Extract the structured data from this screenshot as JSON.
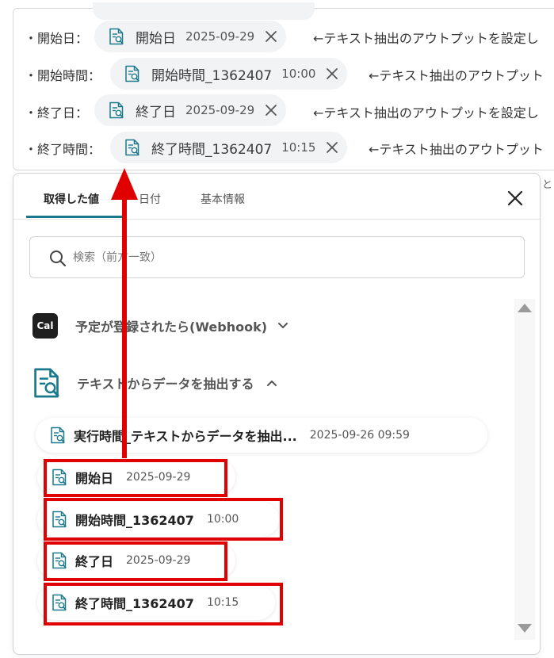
{
  "form": {
    "rows": [
      {
        "label": "・開始日：",
        "chip_name": "開始日",
        "chip_value": "2025-09-29",
        "note": "←テキスト抽出のアウトプットを設定し"
      },
      {
        "label": "・開始時間：",
        "chip_name": "開始時間_1362407",
        "chip_value": "10:00",
        "note": "←テキスト抽出のアウトプット"
      },
      {
        "label": "・終了日：",
        "chip_name": "終了日",
        "chip_value": "2025-09-29",
        "note": "←テキスト抽出のアウトプットを設定し"
      },
      {
        "label": "・終了時間：",
        "chip_name": "終了時間_1362407",
        "chip_value": "10:15",
        "note": "←テキスト抽出のアウトプット"
      }
    ],
    "right_edge_text": "と"
  },
  "dropdown": {
    "tabs": [
      {
        "label": "取得した値",
        "active": true
      },
      {
        "label": "日付",
        "active": false
      },
      {
        "label": "基本情報",
        "active": false
      }
    ],
    "search_placeholder": "検索（前方一致）",
    "sections": [
      {
        "logo_text": "Cal",
        "title": "予定が登録されたら(Webhook)",
        "state": "collapsed"
      },
      {
        "title": "テキストからデータを抽出する",
        "state": "expanded"
      }
    ],
    "items": [
      {
        "name": "実行時間_テキストからデータを抽出...",
        "value": "2025-09-26 09:59",
        "highlighted": false
      },
      {
        "name": "開始日",
        "value": "2025-09-29",
        "highlighted": true
      },
      {
        "name": "開始時間_1362407",
        "value": "10:00",
        "highlighted": true
      },
      {
        "name": "終了日",
        "value": "2025-09-29",
        "highlighted": true
      },
      {
        "name": "終了時間_1362407",
        "value": "10:15",
        "highlighted": true
      }
    ]
  },
  "colors": {
    "accent": "#1a7a8c",
    "annotation": "#e10000",
    "chip_bg": "#f2f3f5"
  }
}
